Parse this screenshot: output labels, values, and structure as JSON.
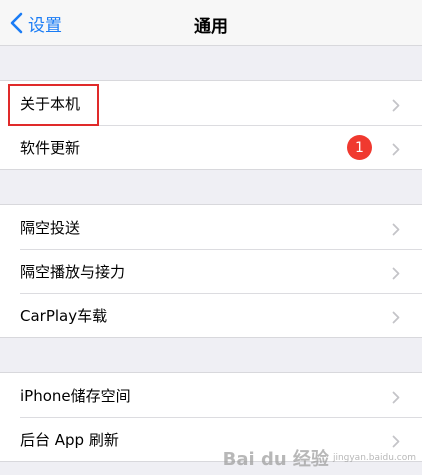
{
  "navbar": {
    "back_label": "设置",
    "title": "通用"
  },
  "groups": [
    {
      "rows": [
        {
          "label": "关于本机"
        },
        {
          "label": "软件更新",
          "badge": "1"
        }
      ]
    },
    {
      "rows": [
        {
          "label": "隔空投送"
        },
        {
          "label": "隔空播放与接力"
        },
        {
          "label": "CarPlay车载"
        }
      ]
    },
    {
      "rows": [
        {
          "label": "iPhone储存空间"
        },
        {
          "label": "后台 App 刷新"
        }
      ]
    }
  ],
  "icons": {
    "back": "chevron-left-icon",
    "disclosure": "chevron-right-icon"
  },
  "colors": {
    "accent": "#1a7cf5",
    "badge": "#f0392f",
    "highlight": "#e02a2a",
    "background": "#efeff4"
  },
  "watermark": {
    "text": "Bai du 经验",
    "sub": "jingyan.baidu.com"
  }
}
